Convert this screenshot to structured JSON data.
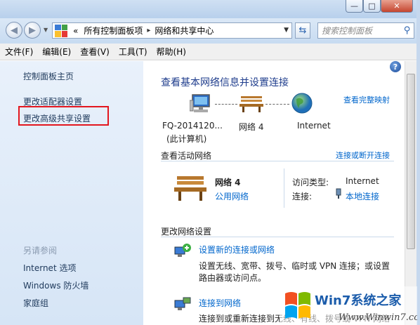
{
  "window": {
    "min_glyph": "—",
    "max_glyph": "□",
    "close_glyph": "✕"
  },
  "address": {
    "prefix": "«",
    "crumbs": [
      "所有控制面板项",
      "网络和共享中心"
    ],
    "separator": "▸",
    "search_placeholder": "搜索控制面板"
  },
  "menu": [
    "文件(F)",
    "编辑(E)",
    "查看(V)",
    "工具(T)",
    "帮助(H)"
  ],
  "sidebar": {
    "links": [
      "控制面板主页",
      "更改适配器设置",
      "更改高级共享设置"
    ],
    "see_also_title": "另请参阅",
    "see_also": [
      "Internet 选项",
      "Windows 防火墙",
      "家庭组"
    ]
  },
  "main": {
    "title": "查看基本网络信息并设置连接",
    "full_map_link": "查看完整映射",
    "map": {
      "computer_name": "FQ-2014120...",
      "computer_sub": "(此计算机)",
      "network": "网络  4",
      "internet": "Internet"
    },
    "active_title": "查看活动网络",
    "connect_link": "连接或断开连接",
    "active_network": {
      "name": "网络  4",
      "type_link": "公用网络",
      "access_label": "访问类型:",
      "access_value": "Internet",
      "conn_label": "连接:",
      "conn_value": "本地连接"
    },
    "change_title": "更改网络设置",
    "tasks": [
      {
        "link": "设置新的连接或网络",
        "desc_line1": "设置无线、宽带、拨号、临时或 VPN 连接；或设置",
        "desc_line2": "路由器或访问点。"
      },
      {
        "link": "连接到网络",
        "desc_line1": "连接到或重新连接到无线、有线、拨号或 VPN 网络"
      }
    ],
    "help_glyph": "?"
  },
  "watermark": {
    "text": "Win7系统之家",
    "url_text": "Www.Winwin7.com"
  },
  "colors": {
    "link": "#0066cc",
    "heading": "#1e3c8c",
    "highlight_border": "#e3161e"
  }
}
